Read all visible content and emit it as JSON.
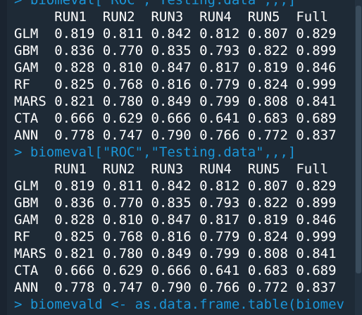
{
  "commands": [
    "> biomeval[\"ROC\",\"Testing.data\",,,]",
    "> biomeval[\"ROC\",\"Testing.data\",,,]",
    "> biomevald <- as.data.frame.table(biomev"
  ],
  "table": {
    "header": "     RUN1  RUN2  RUN3  RUN4  RUN5  Full",
    "rows": [
      "GLM  0.819 0.811 0.842 0.812 0.807 0.829",
      "GBM  0.836 0.770 0.835 0.793 0.822 0.899",
      "GAM  0.828 0.810 0.847 0.817 0.819 0.846",
      "RF   0.825 0.768 0.816 0.779 0.824 0.999",
      "MARS 0.821 0.780 0.849 0.799 0.808 0.841",
      "CTA  0.666 0.629 0.666 0.641 0.683 0.689",
      "ANN  0.778 0.747 0.790 0.766 0.772 0.837"
    ]
  },
  "colors": {
    "background": "#1e2a36",
    "command_text": "#1b96d8",
    "output_text": "#ffffff"
  }
}
